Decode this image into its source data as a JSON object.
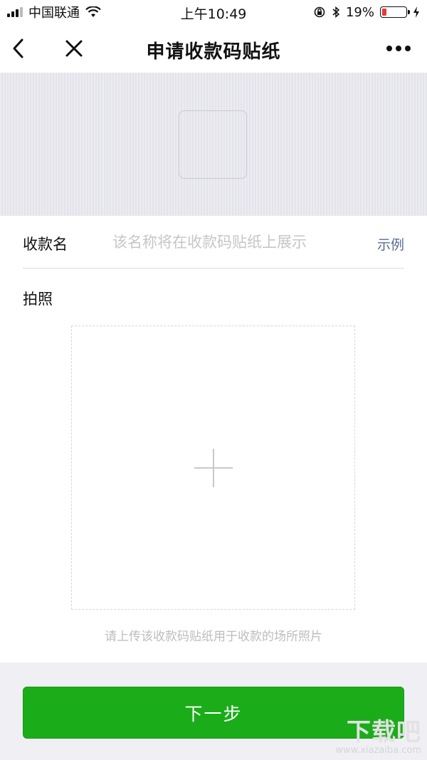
{
  "status_bar": {
    "carrier": "中国联通",
    "time": "上午10:49",
    "battery_percent": "19%",
    "battery_level": 0.19,
    "battery_color": "#e23b3b"
  },
  "nav": {
    "back_icon": "chevron-left-icon",
    "close_icon": "close-icon",
    "title": "申请收款码贴纸",
    "more_icon": "more-dots-icon"
  },
  "form": {
    "name_label": "收款名",
    "name_value": "",
    "name_placeholder": "该名称将在收款码贴纸上展示",
    "example_link": "示例",
    "photo_label": "拍照",
    "upload_icon": "plus-icon",
    "upload_hint": "请上传该收款码贴纸用于收款的场所照片"
  },
  "footer": {
    "next_button": "下一步",
    "accent_color": "#1aad19"
  },
  "watermark": {
    "logo_text": "下载吧",
    "site": "www.xiazaiba.com"
  }
}
